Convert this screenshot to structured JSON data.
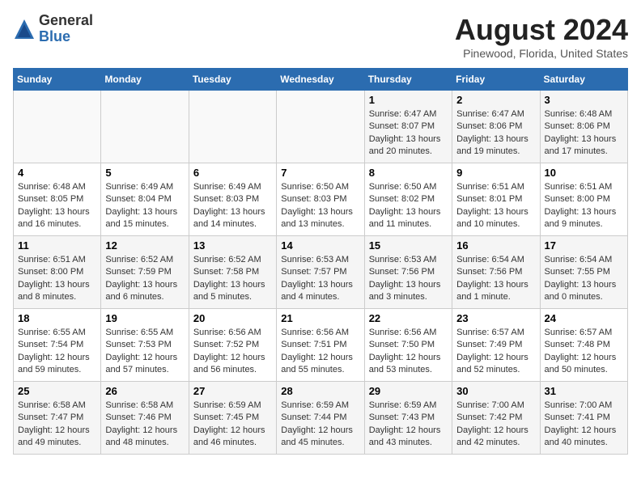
{
  "header": {
    "logo_line1": "General",
    "logo_line2": "Blue",
    "month_title": "August 2024",
    "location": "Pinewood, Florida, United States"
  },
  "weekdays": [
    "Sunday",
    "Monday",
    "Tuesday",
    "Wednesday",
    "Thursday",
    "Friday",
    "Saturday"
  ],
  "weeks": [
    [
      {
        "day": "",
        "info": ""
      },
      {
        "day": "",
        "info": ""
      },
      {
        "day": "",
        "info": ""
      },
      {
        "day": "",
        "info": ""
      },
      {
        "day": "1",
        "info": "Sunrise: 6:47 AM\nSunset: 8:07 PM\nDaylight: 13 hours\nand 20 minutes."
      },
      {
        "day": "2",
        "info": "Sunrise: 6:47 AM\nSunset: 8:06 PM\nDaylight: 13 hours\nand 19 minutes."
      },
      {
        "day": "3",
        "info": "Sunrise: 6:48 AM\nSunset: 8:06 PM\nDaylight: 13 hours\nand 17 minutes."
      }
    ],
    [
      {
        "day": "4",
        "info": "Sunrise: 6:48 AM\nSunset: 8:05 PM\nDaylight: 13 hours\nand 16 minutes."
      },
      {
        "day": "5",
        "info": "Sunrise: 6:49 AM\nSunset: 8:04 PM\nDaylight: 13 hours\nand 15 minutes."
      },
      {
        "day": "6",
        "info": "Sunrise: 6:49 AM\nSunset: 8:03 PM\nDaylight: 13 hours\nand 14 minutes."
      },
      {
        "day": "7",
        "info": "Sunrise: 6:50 AM\nSunset: 8:03 PM\nDaylight: 13 hours\nand 13 minutes."
      },
      {
        "day": "8",
        "info": "Sunrise: 6:50 AM\nSunset: 8:02 PM\nDaylight: 13 hours\nand 11 minutes."
      },
      {
        "day": "9",
        "info": "Sunrise: 6:51 AM\nSunset: 8:01 PM\nDaylight: 13 hours\nand 10 minutes."
      },
      {
        "day": "10",
        "info": "Sunrise: 6:51 AM\nSunset: 8:00 PM\nDaylight: 13 hours\nand 9 minutes."
      }
    ],
    [
      {
        "day": "11",
        "info": "Sunrise: 6:51 AM\nSunset: 8:00 PM\nDaylight: 13 hours\nand 8 minutes."
      },
      {
        "day": "12",
        "info": "Sunrise: 6:52 AM\nSunset: 7:59 PM\nDaylight: 13 hours\nand 6 minutes."
      },
      {
        "day": "13",
        "info": "Sunrise: 6:52 AM\nSunset: 7:58 PM\nDaylight: 13 hours\nand 5 minutes."
      },
      {
        "day": "14",
        "info": "Sunrise: 6:53 AM\nSunset: 7:57 PM\nDaylight: 13 hours\nand 4 minutes."
      },
      {
        "day": "15",
        "info": "Sunrise: 6:53 AM\nSunset: 7:56 PM\nDaylight: 13 hours\nand 3 minutes."
      },
      {
        "day": "16",
        "info": "Sunrise: 6:54 AM\nSunset: 7:56 PM\nDaylight: 13 hours\nand 1 minute."
      },
      {
        "day": "17",
        "info": "Sunrise: 6:54 AM\nSunset: 7:55 PM\nDaylight: 13 hours\nand 0 minutes."
      }
    ],
    [
      {
        "day": "18",
        "info": "Sunrise: 6:55 AM\nSunset: 7:54 PM\nDaylight: 12 hours\nand 59 minutes."
      },
      {
        "day": "19",
        "info": "Sunrise: 6:55 AM\nSunset: 7:53 PM\nDaylight: 12 hours\nand 57 minutes."
      },
      {
        "day": "20",
        "info": "Sunrise: 6:56 AM\nSunset: 7:52 PM\nDaylight: 12 hours\nand 56 minutes."
      },
      {
        "day": "21",
        "info": "Sunrise: 6:56 AM\nSunset: 7:51 PM\nDaylight: 12 hours\nand 55 minutes."
      },
      {
        "day": "22",
        "info": "Sunrise: 6:56 AM\nSunset: 7:50 PM\nDaylight: 12 hours\nand 53 minutes."
      },
      {
        "day": "23",
        "info": "Sunrise: 6:57 AM\nSunset: 7:49 PM\nDaylight: 12 hours\nand 52 minutes."
      },
      {
        "day": "24",
        "info": "Sunrise: 6:57 AM\nSunset: 7:48 PM\nDaylight: 12 hours\nand 50 minutes."
      }
    ],
    [
      {
        "day": "25",
        "info": "Sunrise: 6:58 AM\nSunset: 7:47 PM\nDaylight: 12 hours\nand 49 minutes."
      },
      {
        "day": "26",
        "info": "Sunrise: 6:58 AM\nSunset: 7:46 PM\nDaylight: 12 hours\nand 48 minutes."
      },
      {
        "day": "27",
        "info": "Sunrise: 6:59 AM\nSunset: 7:45 PM\nDaylight: 12 hours\nand 46 minutes."
      },
      {
        "day": "28",
        "info": "Sunrise: 6:59 AM\nSunset: 7:44 PM\nDaylight: 12 hours\nand 45 minutes."
      },
      {
        "day": "29",
        "info": "Sunrise: 6:59 AM\nSunset: 7:43 PM\nDaylight: 12 hours\nand 43 minutes."
      },
      {
        "day": "30",
        "info": "Sunrise: 7:00 AM\nSunset: 7:42 PM\nDaylight: 12 hours\nand 42 minutes."
      },
      {
        "day": "31",
        "info": "Sunrise: 7:00 AM\nSunset: 7:41 PM\nDaylight: 12 hours\nand 40 minutes."
      }
    ]
  ]
}
